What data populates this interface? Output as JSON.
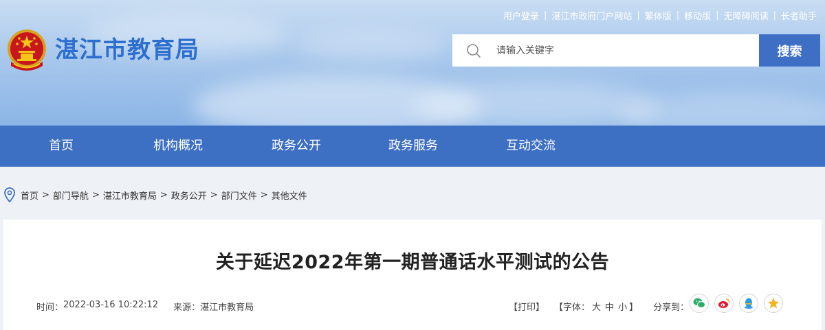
{
  "header": {
    "top_links": [
      "用户登录",
      "湛江市政府门户网站",
      "繁体版",
      "移动版",
      "无障碍阅读",
      "长者助手"
    ],
    "site_title": "湛江市教育局",
    "search": {
      "placeholder": "请输入关键字",
      "button_label": "搜索"
    }
  },
  "nav": {
    "items": [
      "首页",
      "机构概况",
      "政务公开",
      "政务服务",
      "互动交流"
    ]
  },
  "breadcrumb": [
    "首页",
    "部门导航",
    "湛江市教育局",
    "政务公开",
    "部门文件",
    "其他文件"
  ],
  "article": {
    "title": "关于延迟2022年第一期普通话水平测试的公告",
    "time_label": "时间：",
    "time_value": "2022-03-16 10:22:12",
    "source_label": "来源：",
    "source_value": "湛江市教育局",
    "print_label": "【打印】",
    "font_label_open": "【字体：",
    "font_sizes": [
      "大",
      "中",
      "小"
    ],
    "font_label_close": "】",
    "share_label": "分享到："
  },
  "share_icons": [
    "wechat-icon",
    "weibo-icon",
    "qq-icon",
    "qzone-icon"
  ],
  "colors": {
    "nav_bg": "#3d6fc3",
    "search_button": "#3f6fc5",
    "title_blue": "#2d6fcf",
    "wechat": "#2aae67",
    "weibo": "#e6162d",
    "qq": "#2b9ce6",
    "qzone": "#f5b21b"
  }
}
